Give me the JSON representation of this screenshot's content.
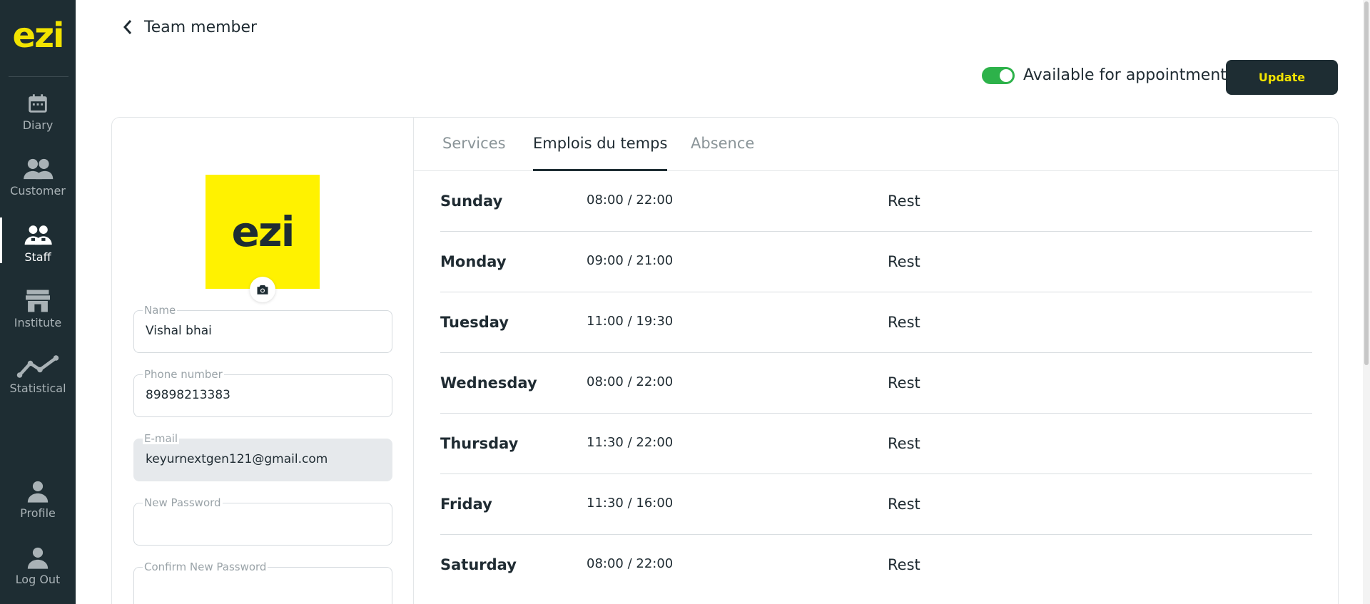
{
  "app": {
    "logo": "ezi"
  },
  "sidebar": {
    "items": [
      {
        "label": "Diary",
        "icon": "calendar-icon"
      },
      {
        "label": "Customer",
        "icon": "users-icon"
      },
      {
        "label": "Staff",
        "icon": "staff-icon"
      },
      {
        "label": "Institute",
        "icon": "store-icon"
      },
      {
        "label": "Statistical",
        "icon": "chart-line-icon"
      },
      {
        "label": "Profile",
        "icon": "user-icon"
      },
      {
        "label": "Log Out",
        "icon": "logout-user-icon"
      }
    ],
    "active": "Staff"
  },
  "header": {
    "title": "Team member",
    "availability_label": "Available for appointment",
    "availability_on": true,
    "update_label": "Update"
  },
  "profile": {
    "avatar_text": "ezi",
    "fields": {
      "name": {
        "label": "Name",
        "value": "Vishal bhai"
      },
      "phone": {
        "label": "Phone number",
        "value": "89898213383"
      },
      "email": {
        "label": "E-mail",
        "value": "keyurnextgen121@gmail.com"
      },
      "new_password": {
        "label": "New Password",
        "value": ""
      },
      "confirm_password": {
        "label": "Confirm New Password",
        "value": ""
      }
    }
  },
  "tabs": [
    {
      "label": "Services"
    },
    {
      "label": "Emplois du temps"
    },
    {
      "label": "Absence"
    }
  ],
  "active_tab": "Emplois du temps",
  "schedule": [
    {
      "day": "Sunday",
      "hours": "08:00 / 22:00",
      "status": "Rest"
    },
    {
      "day": "Monday",
      "hours": "09:00 / 21:00",
      "status": "Rest"
    },
    {
      "day": "Tuesday",
      "hours": "11:00 / 19:30",
      "status": "Rest"
    },
    {
      "day": "Wednesday",
      "hours": "08:00 / 22:00",
      "status": "Rest"
    },
    {
      "day": "Thursday",
      "hours": "11:30 / 22:00",
      "status": "Rest"
    },
    {
      "day": "Friday",
      "hours": "11:30 / 16:00",
      "status": "Rest"
    },
    {
      "day": "Saturday",
      "hours": "08:00 / 22:00",
      "status": "Rest"
    }
  ],
  "colors": {
    "sidebar_bg": "#1e2d33",
    "brand_yellow": "#f2e300",
    "toggle_on": "#2db24a"
  }
}
